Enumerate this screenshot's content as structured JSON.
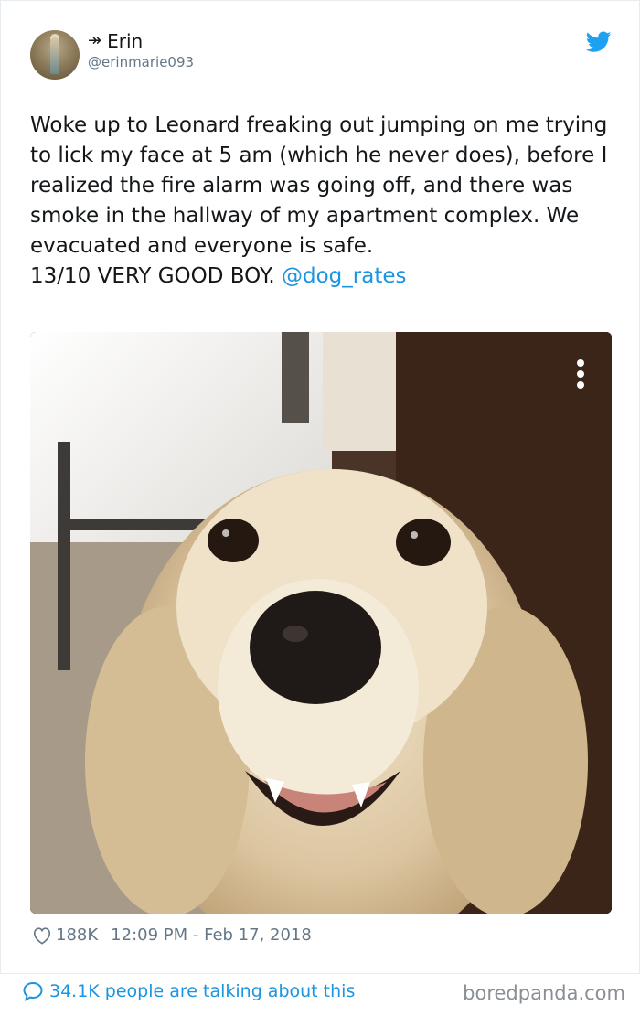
{
  "tweet": {
    "display_name": "Erin",
    "name_prefix_icon": "double-right-arrow-icon",
    "handle": "@erinmarie093",
    "text": "Woke up to Leonard freaking out jumping on me trying to lick my face at 5 am (which he never does), before I realized the fire alarm was going off, and there was smoke in the hallway of my apartment complex. We evacuated and everyone is safe.\n13/10 VERY GOOD BOY. ",
    "mention": "@dog_rates",
    "likes": "188K",
    "timestamp": "12:09 PM - Feb 17, 2018"
  },
  "footer": {
    "talking": "34.1K people are talking about this",
    "watermark": "boredpanda.com"
  },
  "colors": {
    "twitter_blue": "#1b95e0",
    "muted_gray": "#657786"
  }
}
